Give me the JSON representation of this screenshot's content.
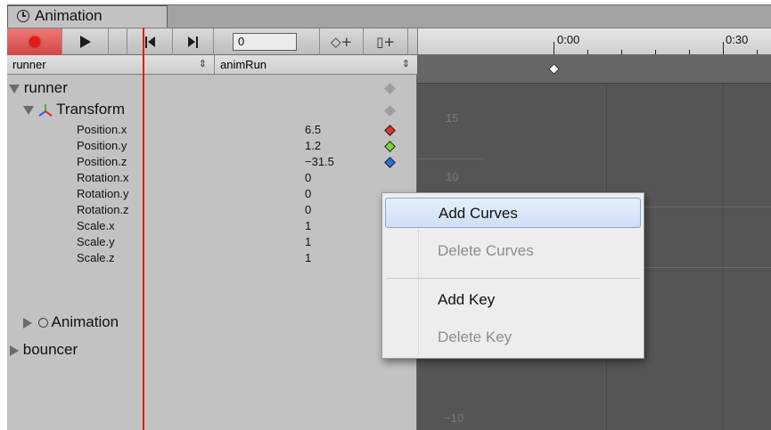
{
  "window": {
    "tab_label": "Animation"
  },
  "toolbar": {
    "frame_value": "0",
    "add_key_glyph": "◇+",
    "add_event_glyph": "▯+"
  },
  "timeline": {
    "labels": [
      "0:00",
      "0:30"
    ]
  },
  "selectors": {
    "object": "runner",
    "clip": "animRun"
  },
  "hierarchy": {
    "root": "runner",
    "transform": "Transform",
    "properties": [
      {
        "name": "Position.x",
        "value": "6.5",
        "key_color": "#d8342a"
      },
      {
        "name": "Position.y",
        "value": "1.2",
        "key_color": "#7fd63a"
      },
      {
        "name": "Position.z",
        "value": "−31.5",
        "key_color": "#2f6ed8"
      },
      {
        "name": "Rotation.x",
        "value": "0"
      },
      {
        "name": "Rotation.y",
        "value": "0"
      },
      {
        "name": "Rotation.z",
        "value": "0"
      },
      {
        "name": "Scale.x",
        "value": "1"
      },
      {
        "name": "Scale.y",
        "value": "1"
      },
      {
        "name": "Scale.z",
        "value": "1"
      }
    ],
    "animation_component": "Animation",
    "second_object": "bouncer"
  },
  "curve_axis": {
    "labels": [
      "15",
      "10",
      "−10"
    ]
  },
  "context_menu": {
    "items": [
      {
        "label": "Add Curves",
        "enabled": true,
        "highlighted": true
      },
      {
        "label": "Delete Curves",
        "enabled": false
      },
      {
        "label": "Add Key",
        "enabled": true
      },
      {
        "label": "Delete Key",
        "enabled": false
      }
    ]
  },
  "colors": {
    "record": "#e81818",
    "playhead": "#e21b1b",
    "menu_highlight": "#cddff6"
  }
}
